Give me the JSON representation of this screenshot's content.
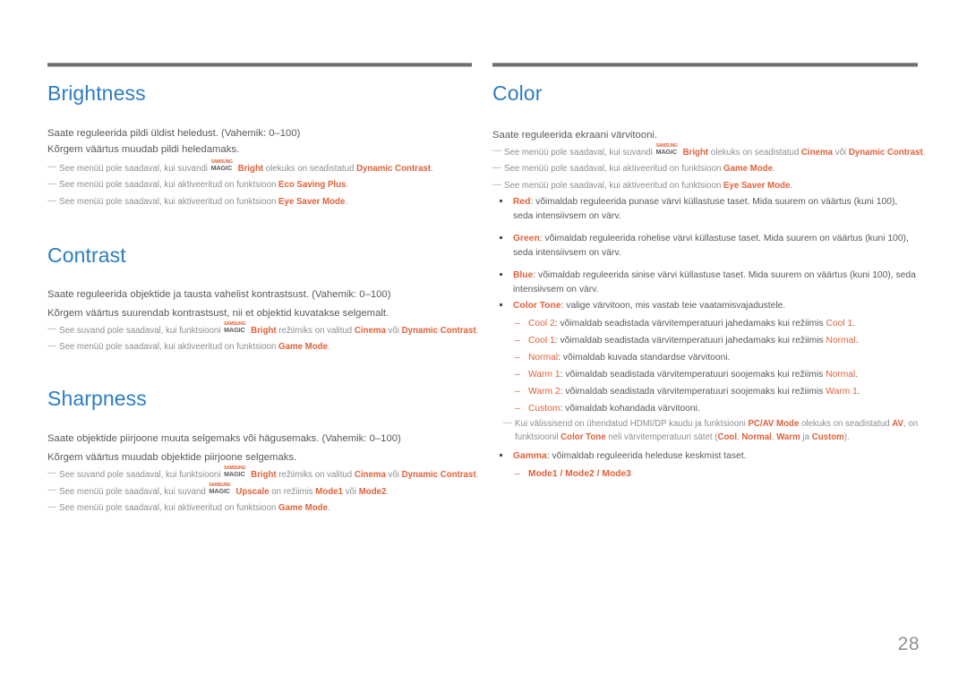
{
  "document": {
    "page_number": "28",
    "colors": {
      "heading": "#2d7dc4",
      "highlight": "#e0613a",
      "body": "#58595b",
      "note": "#8d8e92"
    }
  },
  "left_column": {
    "sections": [
      {
        "title": "Brightness",
        "body": [
          "Saate reguleerida pildi üldist heledust. (Vahemik: 0–100)",
          "Kõrgem väärtus muudab pildi heledamaks."
        ],
        "notes": [
          {
            "pre": "See menüü pole saadaval, kui suvandi ",
            "magic": true,
            "magic_top": "SAMSUNG",
            "magic_bottom": "MAGIC",
            "mid1": "Bright",
            "mid2": " olekuks on seadistatud ",
            "hl1": "Dynamic Contrast",
            "post": "."
          },
          {
            "pre": "See menüü pole saadaval, kui aktiveeritud on funktsioon ",
            "magic": false,
            "hl1": "Eco Saving Plus",
            "post": "."
          },
          {
            "pre": "See menüü pole saadaval, kui aktiveeritud on funktsioon ",
            "magic": false,
            "hl1": "Eye Saver Mode",
            "post": "."
          }
        ]
      },
      {
        "title": "Contrast",
        "body": [
          "Saate reguleerida objektide ja tausta vahelist kontrastsust. (Vahemik: 0–100)",
          "Kõrgem väärtus suurendab kontrastsust, nii et objektid kuvatakse selgemalt."
        ],
        "notes": [
          {
            "pre": "See suvand pole saadaval, kui funktsiooni ",
            "magic": true,
            "magic_top": "SAMSUNG",
            "magic_bottom": "MAGIC",
            "mid1": "Bright",
            "mid2": " režiimiks on valitud ",
            "hl1": "Cinema",
            "mid3": " või ",
            "hl2": "Dynamic Contrast",
            "post": "."
          },
          {
            "pre": "See menüü pole saadaval, kui aktiveeritud on funktsioon ",
            "magic": false,
            "hl1": "Game Mode",
            "post": "."
          }
        ]
      },
      {
        "title": "Sharpness",
        "body": [
          "Saate objektide piirjoone muuta selgemaks või hägusemaks. (Vahemik: 0–100)",
          "Kõrgem väärtus muudab objektide piirjoone selgemaks."
        ],
        "notes": [
          {
            "pre": "See suvand pole saadaval, kui funktsiooni ",
            "magic": true,
            "magic_top": "SAMSUNG",
            "magic_bottom": "MAGIC",
            "mid1": "Bright",
            "mid2": " režiimiks on valitud ",
            "hl1": "Cinema",
            "mid3": " või ",
            "hl2": "Dynamic Contrast",
            "post": "."
          },
          {
            "pre": "See menüü pole saadaval, kui suvand ",
            "magic": true,
            "magic_top": "SAMSUNG",
            "magic_bottom": "MAGIC",
            "mid1": "Upscale",
            "mid2": " on režiimis ",
            "hl1": "Mode1",
            "mid3": " või ",
            "hl2": "Mode2",
            "post": "."
          },
          {
            "pre": "See menüü pole saadaval, kui aktiveeritud on funktsioon ",
            "magic": false,
            "hl1": "Game Mode",
            "post": "."
          }
        ]
      }
    ]
  },
  "right_column": {
    "section": {
      "title": "Color",
      "body": [
        "Saate reguleerida ekraani värvitooni."
      ],
      "notes": [
        {
          "pre": "See menüü pole saadaval, kui suvandi ",
          "magic": true,
          "magic_top": "SAMSUNG",
          "magic_bottom": "MAGIC",
          "mid1": "Bright",
          "mid2": " olekuks on seadistatud ",
          "hl1": "Cinema",
          "mid3": " või ",
          "hl2": "Dynamic Contrast",
          "post": "."
        },
        {
          "pre": "See menüü pole saadaval, kui aktiveeritud on funktsioon ",
          "magic": false,
          "hl1": "Game Mode",
          "post": "."
        },
        {
          "pre": "See menüü pole saadaval, kui aktiveeritud on funktsioon ",
          "magic": false,
          "hl1": "Eye Saver Mode",
          "post": "."
        }
      ],
      "bullets_rgb": [
        {
          "label": "Red",
          "text": ": võimaldab reguleerida punase värvi küllastuse taset. Mida suurem on väärtus (kuni 100), seda intensiivsem on värv."
        },
        {
          "label": "Green",
          "text": ": võimaldab reguleerida rohelise värvi küllastuse taset. Mida suurem on väärtus (kuni 100), seda intensiivsem on värv."
        },
        {
          "label": "Blue",
          "text": ": võimaldab reguleerida sinise värvi küllastuse taset. Mida suurem on väärtus (kuni 100), seda intensiivsem on värv."
        }
      ],
      "color_tone": {
        "label": "Color Tone",
        "text": ": valige värvitoon, mis vastab teie vaatamisvajadustele.",
        "options": [
          {
            "name": "Cool 2",
            "pre": ": võimaldab seadistada värvitemperatuuri jahedamaks kui režiimis ",
            "ref": "Cool 1",
            "post": "."
          },
          {
            "name": "Cool 1",
            "pre": ": võimaldab seadistada värvitemperatuuri jahedamaks kui režiimis ",
            "ref": "Normal",
            "post": "."
          },
          {
            "name": "Normal",
            "pre": ": võimaldab kuvada standardse värvitooni.",
            "ref": "",
            "post": ""
          },
          {
            "name": "Warm 1",
            "pre": ": võimaldab seadistada värvitemperatuuri soojemaks kui režiimis ",
            "ref": "Normal",
            "post": "."
          },
          {
            "name": "Warm 2",
            "pre": ": võimaldab seadistada värvitemperatuuri soojemaks kui režiimis ",
            "ref": "Warm 1",
            "post": "."
          },
          {
            "name": "Custom",
            "pre": ": võimaldab kohandada värvitooni.",
            "ref": "",
            "post": ""
          }
        ]
      },
      "hdmi_note": {
        "p1": "Kui välissisend on ühendatud HDMI/DP kaudu ja funktsiooni ",
        "hl1": "PC/AV Mode",
        "p2": " olekuks on seadistatud ",
        "hl2": "AV",
        "p3": ", on funktsioonil ",
        "hl3": "Color Tone",
        "p4": " neli värvitemperatuuri sätet (",
        "hl4": "Cool",
        "p5": ", ",
        "hl5": "Normal",
        "p6": ", ",
        "hl6": "Warm",
        "p7": " ja ",
        "hl7": "Custom",
        "p8": ")."
      },
      "gamma": {
        "label": "Gamma",
        "text": ": võimaldab reguleerida heleduse keskmist taset.",
        "modes": "Mode1 / Mode2 / Mode3"
      }
    }
  }
}
